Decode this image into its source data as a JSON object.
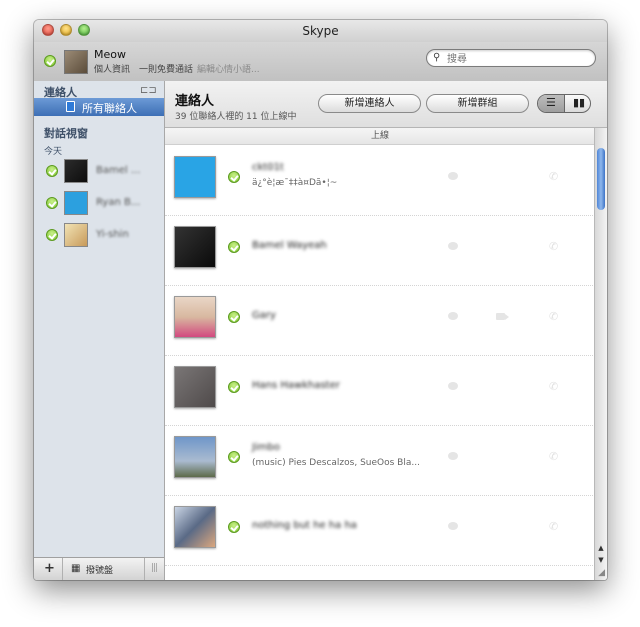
{
  "window": {
    "title": "Skype"
  },
  "profile": {
    "name": "Meow",
    "sub_links": "個人資訊　一則免費通話",
    "mood_hint": "編輯心情小語..."
  },
  "search": {
    "placeholder": "搜尋",
    "value": ""
  },
  "sidebar": {
    "contacts_header": "連絡人",
    "all_contacts": "所有聯絡人",
    "chats_header": "對話視窗",
    "today": "今天",
    "chats": [
      {
        "name": "Bamel ..."
      },
      {
        "name": "Ryan B..."
      },
      {
        "name": "Yi-shin"
      }
    ],
    "footer": {
      "dialpad": "撥號盤"
    }
  },
  "main": {
    "title": "連絡人",
    "subtitle": "39 位聯絡人裡的 11 位上線中",
    "add_contact": "新增連絡人",
    "add_group": "新增群組",
    "group_header": "上線"
  },
  "contacts": [
    {
      "name": "ckt01t",
      "mood": "ä¿°è¦æ¯‡‡à¤Dã•¦~",
      "avatar": "default"
    },
    {
      "name": "Bamel Wayeah",
      "mood": "",
      "avatar": "dark"
    },
    {
      "name": "Gary",
      "mood": "",
      "avatar": "person"
    },
    {
      "name": "Hans Hawkhaster",
      "mood": "",
      "avatar": "gray"
    },
    {
      "name": "Jimbo",
      "mood": "(music) Pies Descalzos, SueOos Bla...",
      "avatar": "sky"
    },
    {
      "name": "nothing but he ha ha",
      "mood": "",
      "avatar": "photo"
    }
  ],
  "colors": {
    "accent": "#3d6fb5",
    "status_online": "#7cc52e"
  }
}
